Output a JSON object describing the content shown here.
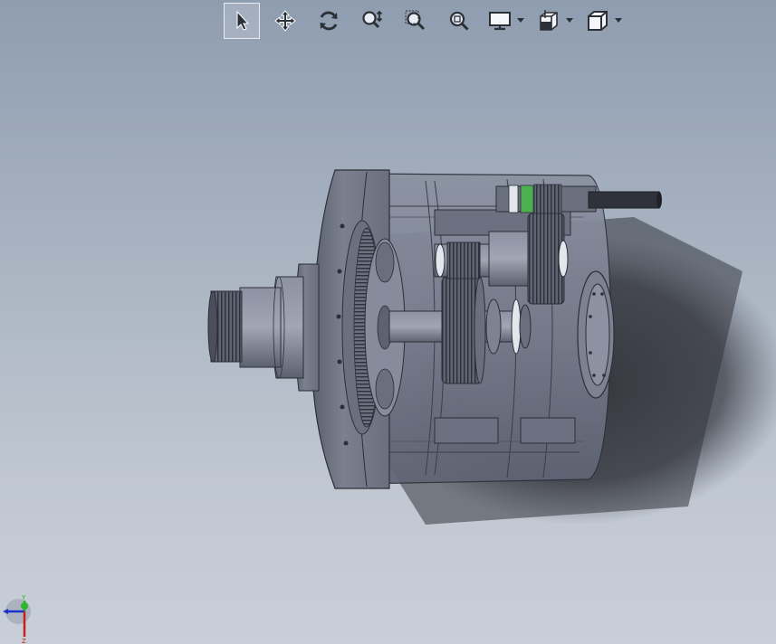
{
  "toolbar": {
    "tools": [
      {
        "id": "select",
        "icon": "cursor-arrow-icon",
        "active": true
      },
      {
        "id": "pan",
        "icon": "pan-arrows-icon",
        "active": false
      },
      {
        "id": "rotate",
        "icon": "rotate-icon",
        "active": false
      },
      {
        "id": "zoom-in-out",
        "icon": "zoom-in-out-icon",
        "active": false
      },
      {
        "id": "zoom-to-area",
        "icon": "zoom-area-icon",
        "active": false
      },
      {
        "id": "zoom-to-fit",
        "icon": "zoom-fit-icon",
        "active": false
      },
      {
        "id": "display-style",
        "icon": "monitor-icon",
        "has_dropdown": true
      },
      {
        "id": "section-view",
        "icon": "section-view-icon",
        "has_dropdown": true
      },
      {
        "id": "view-orientation",
        "icon": "cube-icon",
        "has_dropdown": true
      }
    ]
  },
  "colors": {
    "bg_top": "#8f9db0",
    "bg_bottom": "#c9cfd8",
    "model_body": "#7e8596",
    "model_dark": "#4a4f5c",
    "shadow": "#3a3d45",
    "accent_green": "#4caf50",
    "axis_y": "#2db52d",
    "axis_x": "#1b2fd1",
    "axis_z": "#c8201e"
  },
  "triad": {
    "y_label": "Y",
    "z_label": "Z"
  }
}
